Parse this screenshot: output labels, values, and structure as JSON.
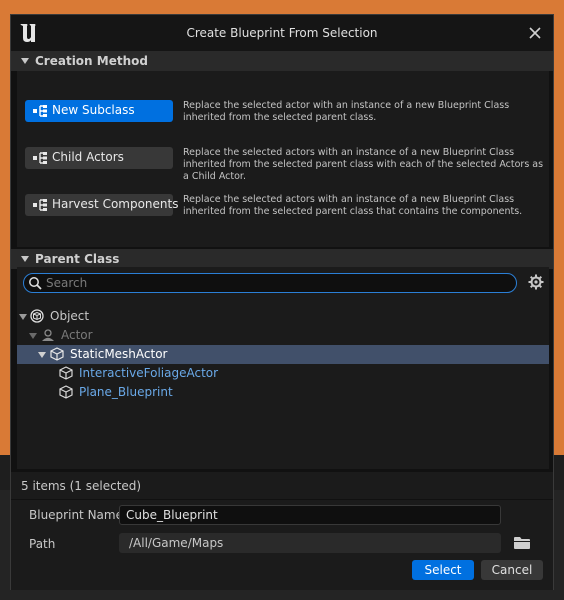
{
  "window": {
    "title": "Create Blueprint From Selection"
  },
  "creation_method": {
    "header": "Creation Method",
    "options": [
      {
        "label": "New Subclass",
        "selected": true,
        "description": "Replace the selected actor with an instance of a new Blueprint Class inherited from the selected parent class."
      },
      {
        "label": "Child Actors",
        "selected": false,
        "description": "Replace the selected actors with an instance of a new Blueprint Class inherited from the selected parent class with each of the selected Actors as a Child Actor."
      },
      {
        "label": "Harvest Components",
        "selected": false,
        "description": "Replace the selected actors with an instance of a new Blueprint Class inherited from the selected parent class that contains the components."
      }
    ]
  },
  "parent_class": {
    "header": "Parent Class",
    "search_placeholder": "Search",
    "tree": [
      {
        "label": "Object",
        "expanded": true,
        "selected": false,
        "icon": "object-icon"
      },
      {
        "label": "Actor",
        "expanded": true,
        "selected": false,
        "icon": "actor-icon"
      },
      {
        "label": "StaticMeshActor",
        "expanded": true,
        "selected": true,
        "icon": "static-mesh-icon"
      },
      {
        "label": "InteractiveFoliageActor",
        "selected": false,
        "icon": "static-mesh-icon"
      },
      {
        "label": "Plane_Blueprint",
        "selected": false,
        "icon": "static-mesh-icon"
      }
    ]
  },
  "footer": {
    "item_count": "5 items (1 selected)",
    "blueprint_name_label": "Blueprint Name",
    "blueprint_name_value": "Cube_Blueprint",
    "path_label": "Path",
    "path_value": "/All/Game/Maps",
    "select_label": "Select",
    "cancel_label": "Cancel"
  },
  "colors": {
    "accent": "#0070e0",
    "selection": "#41506a",
    "background": "#d97a36",
    "link_text": "#6aa9e8"
  }
}
